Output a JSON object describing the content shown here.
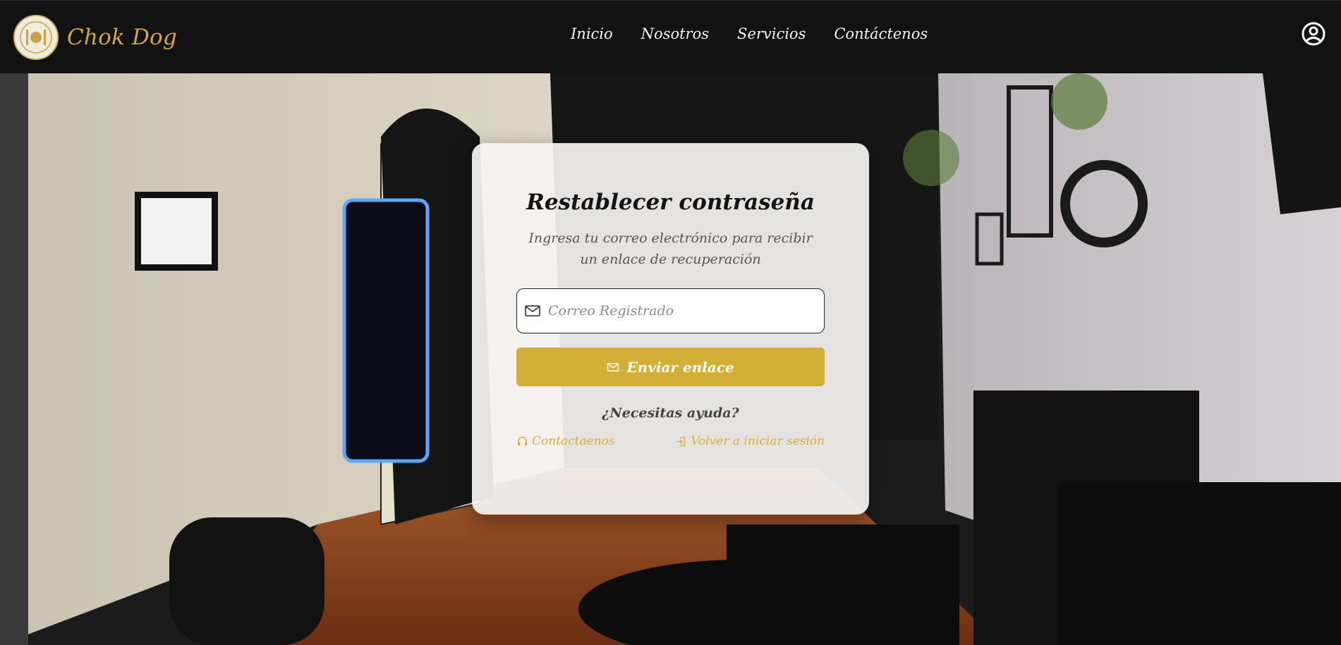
{
  "header": {
    "brand_name": "Chok Dog",
    "nav": [
      {
        "label": "Inicio"
      },
      {
        "label": "Nosotros"
      },
      {
        "label": "Servicios"
      },
      {
        "label": "Contáctenos"
      }
    ],
    "user_icon": "user-circle-icon"
  },
  "card": {
    "title": "Restablecer contraseña",
    "subtitle": "Ingresa tu correo electrónico para recibir un enlace de recuperación",
    "email_placeholder": "Correo Registrado",
    "email_value": "",
    "submit_label": "Enviar enlace",
    "help_text": "¿Necesitas ayuda?",
    "contact_label": "Contactaenos",
    "login_label": "Volver a iniciar sesión"
  },
  "colors": {
    "accent": "#d4af37",
    "header_bg": "#121212",
    "card_bg": "#f5f3f1"
  },
  "icons": [
    "mail-icon",
    "headset-icon",
    "login-icon",
    "user-circle-icon"
  ]
}
